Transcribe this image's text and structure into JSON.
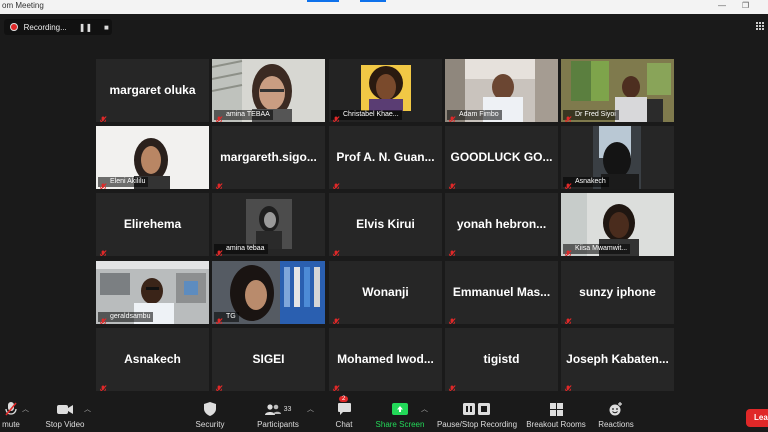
{
  "window": {
    "title": "om Meeting"
  },
  "recording": {
    "label": "Recording..."
  },
  "participants": [
    {
      "name": "margaret oluka",
      "video": false,
      "label": ""
    },
    {
      "name": "",
      "video": true,
      "label": "amina TEBAA",
      "scene": "woman-glasses"
    },
    {
      "name": "",
      "video": true,
      "label": "Christabel Khae...",
      "scene": "woman-curly"
    },
    {
      "name": "",
      "video": true,
      "label": "Adam Fimbo",
      "scene": "man-car"
    },
    {
      "name": "",
      "video": true,
      "label": "Dr Fred Siyoi",
      "scene": "man-office"
    },
    {
      "name": "",
      "video": true,
      "label": "Eleni Akililu",
      "scene": "woman-white"
    },
    {
      "name": "margareth.sigo...",
      "video": false,
      "label": ""
    },
    {
      "name": "Prof  A. N. Guan...",
      "video": false,
      "label": ""
    },
    {
      "name": "GOODLUCK  GO...",
      "video": false,
      "label": ""
    },
    {
      "name": "",
      "video": true,
      "label": "Asnakech",
      "scene": "dark-window"
    },
    {
      "name": "Elirehema",
      "video": false,
      "label": ""
    },
    {
      "name": "",
      "video": true,
      "label": "amina tebaa",
      "scene": "photo-small",
      "active": true
    },
    {
      "name": "Elvis Kirui",
      "video": false,
      "label": ""
    },
    {
      "name": "yonah  hebron...",
      "video": false,
      "label": ""
    },
    {
      "name": "",
      "video": true,
      "label": "Kiisa Mwamwit...",
      "scene": "woman-light"
    },
    {
      "name": "",
      "video": true,
      "label": "geraldsambu",
      "scene": "man-lab"
    },
    {
      "name": "",
      "video": true,
      "label": "TG",
      "scene": "woman-shelves"
    },
    {
      "name": "Wonanji",
      "video": false,
      "label": ""
    },
    {
      "name": "Emmanuel  Mas...",
      "video": false,
      "label": ""
    },
    {
      "name": "sunzy iphone",
      "video": false,
      "label": ""
    },
    {
      "name": "Asnakech",
      "video": false,
      "label": ""
    },
    {
      "name": "SIGEI",
      "video": false,
      "label": ""
    },
    {
      "name": "Mohamed  Iwod...",
      "video": false,
      "label": ""
    },
    {
      "name": "tigistd",
      "video": false,
      "label": ""
    },
    {
      "name": "Joseph  Kabaten...",
      "video": false,
      "label": ""
    }
  ],
  "toolbar": {
    "mute": "mute",
    "stop_video": "Stop Video",
    "security": "Security",
    "participants": "Participants",
    "participants_count": "33",
    "chat": "Chat",
    "chat_badge": "2",
    "share_screen": "Share Screen",
    "recording": "Pause/Stop Recording",
    "breakout": "Breakout Rooms",
    "reactions": "Reactions",
    "leave": "Lea"
  },
  "colors": {
    "active_speaker": "#9ed53a",
    "share_green": "#23d959",
    "leave_red": "#e02828",
    "muted_red": "#e02828"
  }
}
